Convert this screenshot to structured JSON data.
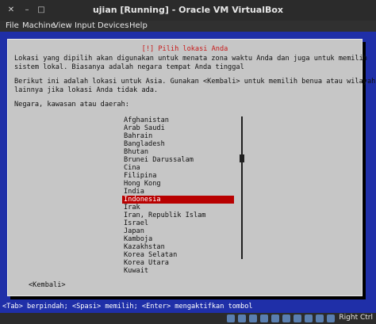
{
  "window": {
    "title": "ujian [Running] - Oracle VM VirtualBox",
    "host_key": "Right Ctrl"
  },
  "menubar": [
    "File",
    "Machine",
    "View",
    "Input",
    "Devices",
    "Help"
  ],
  "dialog": {
    "title": "[!] Pilih lokasi Anda",
    "paragraph1": [
      "Lokasi yang dipilih akan digunakan untuk menata zona waktu Anda dan juga untuk memilih",
      "sistem lokal. Biasanya adalah negara tempat Anda tinggal"
    ],
    "paragraph2": [
      "Berikut ini adalah lokasi untuk Asia. Gunakan <Kembali> untuk memilih benua atau wilayah",
      "lainnya jika lokasi Anda tidak ada."
    ],
    "prompt": "Negara, kawasan atau daerah:",
    "countries": [
      "Afghanistan",
      "Arab Saudi",
      "Bahrain",
      "Bangladesh",
      "Bhutan",
      "Brunei Darussalam",
      "Cina",
      "Filipina",
      "Hong Kong",
      "India",
      "Indonesia",
      "Irak",
      "Iran, Republik Islam",
      "Israel",
      "Japan",
      "Kamboja",
      "Kazakhstan",
      "Korea Selatan",
      "Korea Utara",
      "Kuwait"
    ],
    "selected_country": "Indonesia",
    "back_button": "<Kembali>"
  },
  "hint_bar": "<Tab> berpindah; <Spasi> memilih; <Enter> mengaktifkan tombol",
  "colors": {
    "vm_background": "#1f2fa8",
    "dialog_background": "#c6c6c6",
    "selection": "#b80000",
    "title_red": "#c81818"
  }
}
